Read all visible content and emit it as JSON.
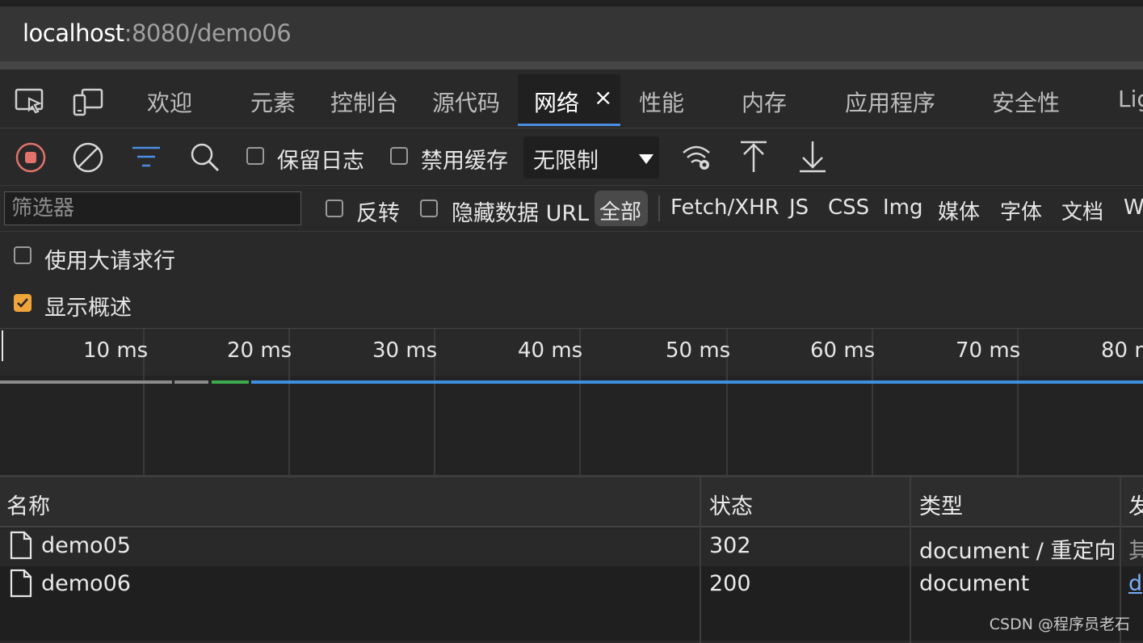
{
  "address": {
    "host": "localhost",
    "path": ":8080/demo06"
  },
  "tabs": {
    "items": [
      "欢迎",
      "元素",
      "控制台",
      "源代码",
      "网络",
      "性能",
      "内存",
      "应用程序",
      "安全性",
      "Lig"
    ],
    "active": "网络",
    "close_glyph": "×"
  },
  "toolbar": {
    "preserve_log": "保留日志",
    "disable_cache": "禁用缓存",
    "throttle": "无限制"
  },
  "filter": {
    "placeholder": "筛选器",
    "invert": "反转",
    "hide_data_url": "隐藏数据 URL",
    "types": [
      "全部",
      "Fetch/XHR",
      "JS",
      "CSS",
      "Img",
      "媒体",
      "字体",
      "文档",
      "W"
    ]
  },
  "options": {
    "large_rows": {
      "label": "使用大请求行",
      "checked": false
    },
    "overview": {
      "label": "显示概述",
      "checked": true
    }
  },
  "timeline": {
    "ticks": [
      "10 ms",
      "20 ms",
      "30 ms",
      "40 ms",
      "50 ms",
      "60 ms",
      "70 ms",
      "80 m"
    ],
    "colors": {
      "gray": "#8a8a8a",
      "green": "#3dab4f",
      "blue": "#3d8fe0"
    }
  },
  "table": {
    "columns": [
      "名称",
      "状态",
      "类型",
      "发"
    ],
    "rows": [
      {
        "name": "demo05",
        "status": "302",
        "type": "document / 重定向",
        "initiator": "其"
      },
      {
        "name": "demo06",
        "status": "200",
        "type": "document",
        "initiator": "d"
      }
    ]
  },
  "watermark": "CSDN @程序员老石"
}
